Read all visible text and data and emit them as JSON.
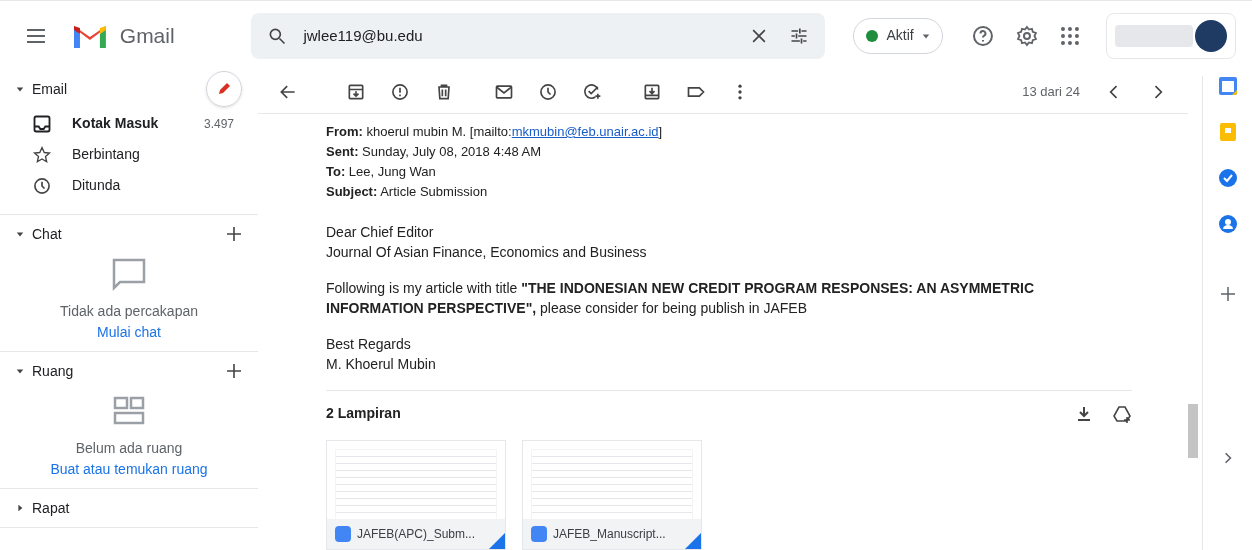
{
  "header": {
    "app_name": "Gmail",
    "search": {
      "value": "jwlee119@bu.edu"
    },
    "status": {
      "label": "Aktif",
      "color": "#1e8e3e"
    }
  },
  "sidebar": {
    "sections": [
      {
        "kind": "mail",
        "label": "Email",
        "expanded": true,
        "items": [
          {
            "kind": "inbox",
            "label": "Kotak Masuk",
            "count": "3.497",
            "selected": true
          },
          {
            "kind": "starred",
            "label": "Berbintang",
            "selected": false
          },
          {
            "kind": "snoozed",
            "label": "Ditunda",
            "selected": false
          }
        ]
      },
      {
        "kind": "chat",
        "label": "Chat",
        "expanded": true,
        "empty_text": "Tidak ada percakapan",
        "link": "Mulai chat"
      },
      {
        "kind": "rooms",
        "label": "Ruang",
        "expanded": true,
        "empty_text": "Belum ada ruang",
        "link": "Buat atau temukan ruang"
      },
      {
        "kind": "meet",
        "label": "Rapat",
        "expanded": false
      }
    ]
  },
  "toolbar": {
    "counter": "13 dari 24"
  },
  "message": {
    "header_lines": [
      {
        "kind": "link",
        "before": "**From:** khoerul mubin M. [mailto:",
        "link": "mkmubin@feb.unair.ac.id",
        "after": "]"
      },
      {
        "kind": "text",
        "text": "**Sent:** Sunday, July 08, 2018 4:48 AM"
      },
      {
        "kind": "text",
        "text": "**To:** Lee, Jung Wan"
      },
      {
        "kind": "text",
        "text": "**Subject:** Article Submission"
      }
    ],
    "paragraphs": [
      [
        "Dear Chief Editor",
        "Journal Of Asian Finance, Economics and Business"
      ],
      [
        "Following is my article with title **\"THE INDONESIAN NEW CREDIT PROGRAM RESPONSES: AN ASYMMETRIC INFORMATION PERSPECTIVE\",** please consider for being publish in JAFEB"
      ],
      [
        "Best Regards",
        "M. Khoerul Mubin"
      ]
    ],
    "attachments": {
      "title": "2 Lampiran",
      "files": [
        {
          "name": "JAFEB(APC)_Subm..."
        },
        {
          "name": "JAFEB_Manuscript..."
        }
      ]
    }
  }
}
